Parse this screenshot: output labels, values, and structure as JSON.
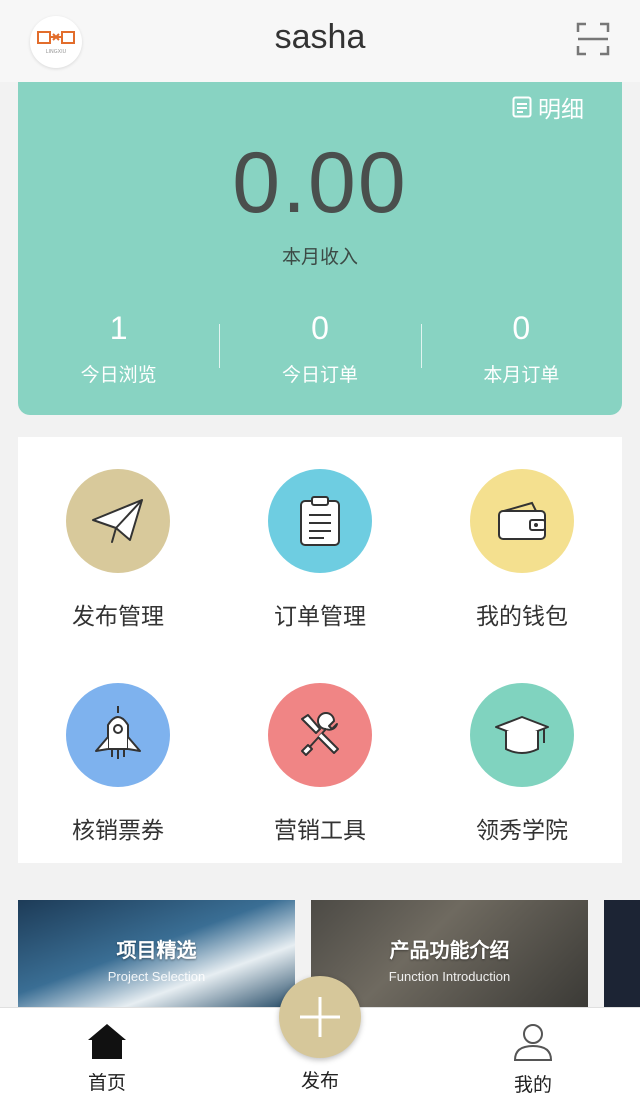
{
  "header": {
    "title": "sasha",
    "logo_text": "LINGXIU"
  },
  "income": {
    "detail_label": "明细",
    "value": "0.00",
    "label": "本月收入",
    "stats": [
      {
        "value": "1",
        "label": "今日浏览"
      },
      {
        "value": "0",
        "label": "今日订单"
      },
      {
        "value": "0",
        "label": "本月订单"
      }
    ],
    "accent": "#88d3c2"
  },
  "menu": [
    {
      "label": "发布管理",
      "icon": "paper-plane-icon",
      "color": "#d8c99b"
    },
    {
      "label": "订单管理",
      "icon": "clipboard-icon",
      "color": "#6ecde1"
    },
    {
      "label": "我的钱包",
      "icon": "wallet-icon",
      "color": "#f4e08f"
    },
    {
      "label": "核销票券",
      "icon": "rocket-icon",
      "color": "#7eb2ee"
    },
    {
      "label": "营销工具",
      "icon": "tools-icon",
      "color": "#f08585"
    },
    {
      "label": "领秀学院",
      "icon": "graduation-cap-icon",
      "color": "#80d3bf"
    }
  ],
  "banners": [
    {
      "title": "项目精选",
      "subtitle": "Project Selection"
    },
    {
      "title": "产品功能介绍",
      "subtitle": "Function Introduction"
    }
  ],
  "tabbar": {
    "home": "首页",
    "publish": "发布",
    "mine": "我的",
    "publish_color": "#d6c79a"
  }
}
